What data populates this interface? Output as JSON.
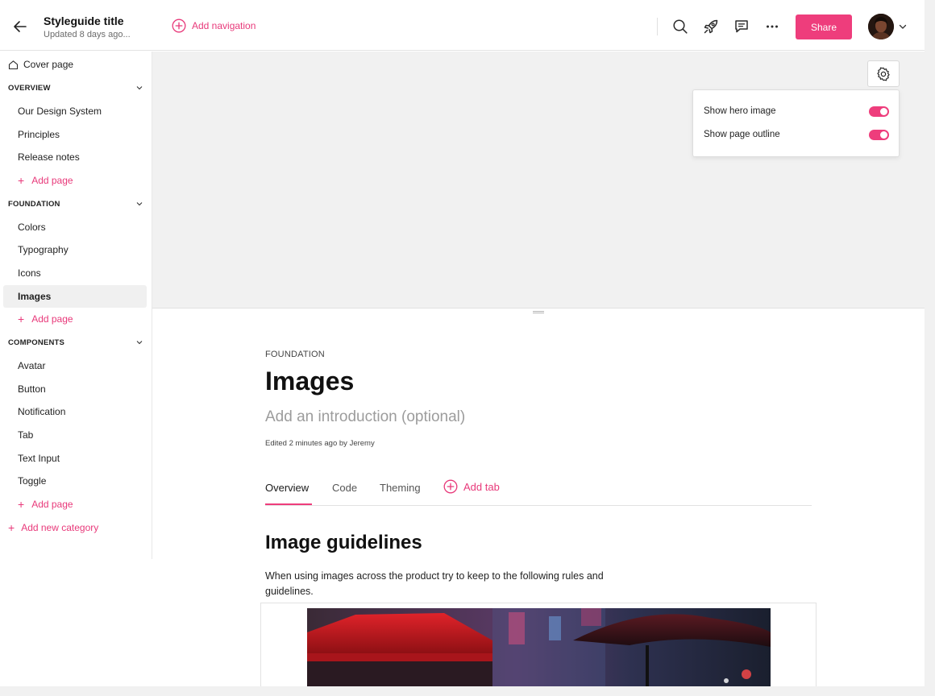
{
  "header": {
    "title": "Styleguide title",
    "subtitle": "Updated 8 days ago...",
    "add_navigation": "Add navigation",
    "share_label": "Share",
    "icons": [
      "arrow-left-icon",
      "plus-circle-icon",
      "search-icon",
      "rocket-icon",
      "comment-icon",
      "more-icon",
      "chevron-down-icon"
    ]
  },
  "sidebar": {
    "cover": "Cover page",
    "categories": [
      {
        "label": "OVERVIEW",
        "items": [
          "Our Design System",
          "Principles",
          "Release notes"
        ]
      },
      {
        "label": "FOUNDATION",
        "items": [
          "Colors",
          "Typography",
          "Icons",
          "Images"
        ]
      },
      {
        "label": "COMPONENTS",
        "items": [
          "Avatar",
          "Button",
          "Notification",
          "Tab",
          "Text Input",
          "Toggle"
        ]
      }
    ],
    "add_page": "Add page",
    "active_item": "Images",
    "add_category": "Add new category"
  },
  "settings": {
    "rows": [
      {
        "label": "Show hero image",
        "on": true
      },
      {
        "label": "Show page outline",
        "on": true
      }
    ]
  },
  "page": {
    "eyebrow": "FOUNDATION",
    "title": "Images",
    "intro_placeholder": "Add an introduction (optional)",
    "edited": "Edited 2 minutes ago by Jeremy",
    "tabs": [
      "Overview",
      "Code",
      "Theming"
    ],
    "active_tab": "Overview",
    "add_tab": "Add tab",
    "section_title": "Image guidelines",
    "section_text": "When using images across the product try to keep to the following rules and guidelines."
  },
  "colors": {
    "accent": "#ee3d7c",
    "hero_bg": "#f1f1f1"
  }
}
